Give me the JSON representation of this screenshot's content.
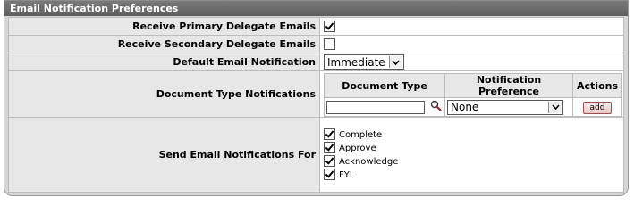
{
  "section": {
    "title": "Email Notification Preferences"
  },
  "rows": {
    "primary": {
      "label": "Receive Primary Delegate Emails",
      "checked": true
    },
    "secondary": {
      "label": "Receive Secondary Delegate Emails",
      "checked": false
    },
    "default": {
      "label": "Default Email Notification",
      "value": "Immediate"
    },
    "doc_types": {
      "label": "Document Type Notifications",
      "col_doc_type": "Document Type",
      "col_pref": "Notification Preference",
      "col_actions": "Actions",
      "doc_type_value": "",
      "pref_value": "None",
      "add_label": "add"
    },
    "send_for": {
      "label": "Send Email Notifications For",
      "options": [
        {
          "label": "Complete",
          "checked": true
        },
        {
          "label": "Approve",
          "checked": true
        },
        {
          "label": "Acknowledge",
          "checked": true
        },
        {
          "label": "FYI",
          "checked": true
        }
      ]
    }
  },
  "icons": {
    "lookup": "magnifier-icon",
    "dropdown": "chevron-down-icon"
  }
}
